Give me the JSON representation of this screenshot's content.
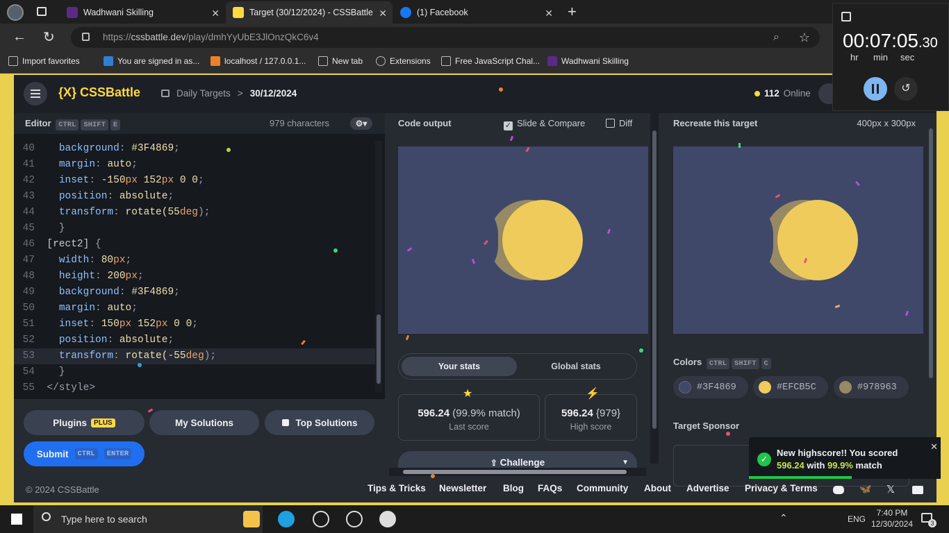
{
  "browser": {
    "tabs": [
      {
        "title": "Wadhwani Skilling"
      },
      {
        "title": "Target (30/12/2024) - CSSBattle"
      },
      {
        "title": "(1) Facebook"
      }
    ],
    "url_prefix": "https://",
    "url_host": "cssbattle.dev",
    "url_path": "/play/dmhYyUbE3JlOnzQkC6v4",
    "favorites": [
      {
        "label": "Import favorites"
      },
      {
        "label": "You are signed in as..."
      },
      {
        "label": "localhost / 127.0.0.1..."
      },
      {
        "label": "New tab"
      },
      {
        "label": "Extensions"
      },
      {
        "label": "Free JavaScript Chal..."
      },
      {
        "label": "Wadhwani Skilling"
      }
    ]
  },
  "timer": {
    "time_main": "00:07:05",
    "time_frac": ".30",
    "units": [
      "hr",
      "min",
      "sec"
    ]
  },
  "site": {
    "logo_brackets": "{X}",
    "logo": "CSSBattle",
    "breadcrumb_root": "Daily Targets",
    "breadcrumb_sep": ">",
    "breadcrumb_current": "30/12/2024",
    "online_count": "112",
    "online_label": "Online"
  },
  "editor": {
    "title": "Editor",
    "shortcut": [
      "CTRL",
      "SHIFT",
      "E"
    ],
    "char_count": "979 characters",
    "lines": [
      {
        "n": "40",
        "indent": "    ",
        "prop": "background",
        "val": "#3F4869",
        "unit": "",
        "end": ";"
      },
      {
        "n": "41",
        "indent": "    ",
        "prop": "margin",
        "val": "auto",
        "unit": "",
        "end": ";"
      },
      {
        "n": "42",
        "indent": "    ",
        "prop": "inset",
        "val": "-150",
        "unit": "px",
        "rest": " 152",
        "unit2": "px",
        "tail": " 0 0",
        "end": ";"
      },
      {
        "n": "43",
        "indent": "    ",
        "prop": "position",
        "val": "absolute",
        "unit": "",
        "end": ";"
      },
      {
        "n": "44",
        "indent": "    ",
        "prop": "transform",
        "fn": "rotate(",
        "val": "55",
        "unit": "deg",
        "close": ")",
        "end": ";"
      }
    ],
    "line45": {
      "n": "45",
      "text": "  }"
    },
    "line46": {
      "n": "46",
      "sel": "[rect2]",
      "brace": " {"
    },
    "lines2": [
      {
        "n": "47",
        "prop": "width",
        "val": "80",
        "unit": "px"
      },
      {
        "n": "48",
        "prop": "height",
        "val": "200",
        "unit": "px"
      },
      {
        "n": "49",
        "prop": "background",
        "val": "#3F4869",
        "unit": ""
      },
      {
        "n": "50",
        "prop": "margin",
        "val": "auto",
        "unit": ""
      },
      {
        "n": "51",
        "prop": "inset",
        "val": "150",
        "unit": "px",
        "rest": " 152",
        "unit2": "px",
        "tail": " 0 0"
      },
      {
        "n": "52",
        "prop": "position",
        "val": "absolute",
        "unit": ""
      },
      {
        "n": "53",
        "prop": "transform",
        "fn": "rotate(",
        "val": "-55",
        "unit": "deg",
        "close": ")"
      }
    ],
    "line54": {
      "n": "54",
      "text": "  }"
    },
    "line55": {
      "n": "55",
      "text": "</style>"
    }
  },
  "buttons": {
    "plugins": "Plugins",
    "plugins_badge": "PLUS",
    "my_solutions": "My Solutions",
    "top_solutions": "Top Solutions",
    "submit": "Submit",
    "submit_keys": [
      "CTRL",
      "ENTER"
    ]
  },
  "output": {
    "title": "Code output",
    "slide_compare": "Slide & Compare",
    "diff": "Diff",
    "tabs": [
      "Your stats",
      "Global stats"
    ],
    "last_score": "596.24",
    "last_match": "(99.9% match)",
    "last_label": "Last score",
    "high_score": "596.24",
    "high_chars": "{979}",
    "high_label": "High score",
    "challenge": "Challenge"
  },
  "target": {
    "title": "Recreate this target",
    "size": "400px x 300px",
    "colors_label": "Colors",
    "colors_keys": [
      "CTRL",
      "SHIFT",
      "C"
    ],
    "colors": [
      {
        "hex": "#3F4869"
      },
      {
        "hex": "#EFCB5C"
      },
      {
        "hex": "#978963"
      }
    ],
    "sponsor": "Target Sponsor"
  },
  "toast": {
    "line1": "New highscore!! You scored",
    "score": "596.24",
    "with": "with",
    "match": "99.9%",
    "match_word": "match"
  },
  "footer": {
    "copyright": "© 2024 CSSBattle",
    "links": [
      "Tips & Tricks",
      "Newsletter",
      "Blog",
      "FAQs",
      "Community",
      "About",
      "Advertise",
      "Privacy & Terms"
    ]
  },
  "taskbar": {
    "search": "Type here to search",
    "lang": "ENG",
    "time": "7:40 PM",
    "date": "12/30/2024",
    "notif": "3"
  },
  "palette": {
    "bg": "#3F4869",
    "moon": "#EFCB5C",
    "shadow": "#978963",
    "accent": "#ffd93d",
    "green": "#1fc54a"
  }
}
